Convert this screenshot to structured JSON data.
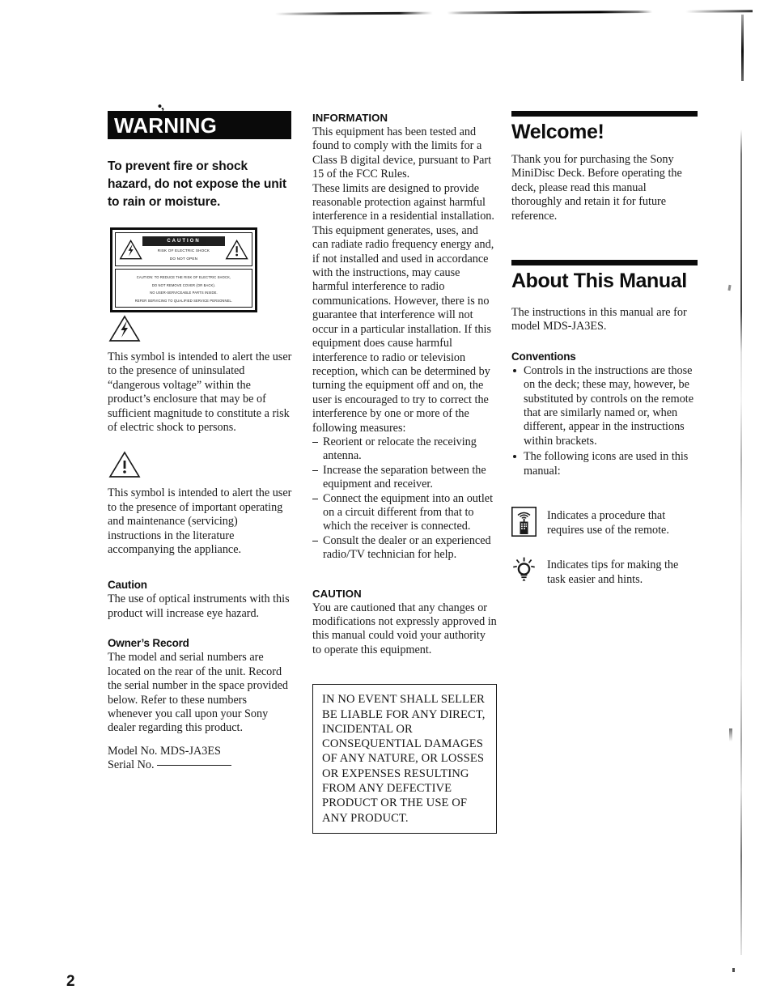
{
  "page": {
    "number": "2",
    "document_type": "owner-manual-page",
    "model": "MDS-JA3ES"
  },
  "artifacts": {
    "smudge_mark": "•,"
  },
  "left_column": {
    "warning_banner": "WARNING",
    "warning_lead": "To prevent fire or shock hazard, do not expose the unit to rain or moisture.",
    "caution_plate": {
      "caution_bar": "CAUTION",
      "line1": "RISK OF ELECTRIC SHOCK",
      "line2": "DO NOT OPEN",
      "bottom_line1": "CAUTION: TO REDUCE THE RISK OF ELECTRIC SHOCK,",
      "bottom_line2": "DO NOT REMOVE COVER (OR BACK).",
      "bottom_line3": "NO USER-SERVICEABLE PARTS INSIDE.",
      "bottom_line4": "REFER SERVICING TO QUALIFIED SERVICE PERSONNEL.",
      "left_symbol": "lightning-bolt-triangle-icon",
      "right_symbol": "exclamation-triangle-icon"
    },
    "lightning_symbol_text": "This symbol is intended to alert the user to the presence of uninsulated “dangerous voltage” within the product’s enclosure that may be of sufficient magnitude to constitute a risk of electric shock to persons.",
    "exclamation_symbol_text": "This symbol is intended to alert the user to the presence of important operating and maintenance (servicing) instructions in the literature accompanying the appliance.",
    "caution_heading": "Caution",
    "caution_text": "The use of optical instruments with this product will increase eye hazard.",
    "owners_record_heading": "Owner’s Record",
    "owners_record_text": "The model and serial numbers are located on the rear of the unit. Record the serial number in the space provided below. Refer to these numbers whenever you call upon your Sony dealer regarding this product.",
    "model_no_label": "Model No. MDS-JA3ES",
    "serial_no_label": "Serial No."
  },
  "middle_column": {
    "information_heading": "INFORMATION",
    "information_p1": "This equipment has been tested and found to comply with the limits for a Class B digital device, pursuant to Part 15 of the FCC Rules.",
    "information_p2": "These limits are designed to provide reasonable protection against harmful interference in a residential installation. This equipment generates, uses, and can radiate radio frequency energy and, if not installed and used in accordance with the instructions, may cause harmful interference to radio communications. However, there is no guarantee that interference will not occur in a particular installation. If this equipment does cause harmful interference to radio or television reception, which can be determined by turning the equipment off and on, the user is encouraged to try to correct the interference by one or more of the following measures:",
    "measures": [
      "Reorient or relocate the receiving antenna.",
      "Increase the separation between the equipment and receiver.",
      "Connect the equipment into an outlet on a circuit different from that to which the receiver is connected.",
      "Consult the dealer or an experienced radio/TV technician for help."
    ],
    "caution_heading": "CAUTION",
    "caution_text": "You are cautioned that any changes or modifications not expressly approved in this manual could void your authority to operate this equipment.",
    "liability_notice": "IN NO EVENT SHALL SELLER BE LIABLE FOR ANY DIRECT, INCIDENTAL OR CONSEQUENTIAL DAMAGES OF ANY NATURE, OR LOSSES OR EXPENSES RESULTING FROM ANY DEFECTIVE PRODUCT OR THE USE OF ANY PRODUCT."
  },
  "right_column": {
    "welcome_heading": "Welcome!",
    "welcome_text": "Thank you for purchasing the Sony MiniDisc Deck.  Before operating the deck, please read this manual thoroughly and retain it for future reference.",
    "about_heading": "About This Manual",
    "about_text": "The instructions in this manual are for model MDS-JA3ES.",
    "conventions_heading": "Conventions",
    "conventions_bullets": [
      "Controls in the instructions are those on the deck; these may, however, be substituted by controls on the remote that are similarly named or, when different, appear in the instructions within brackets.",
      "The following icons are used in this manual:"
    ],
    "icon_legend": [
      {
        "icon": "remote-control-icon",
        "text": "Indicates a procedure that requires use of the remote."
      },
      {
        "icon": "light-bulb-tip-icon",
        "text": "Indicates tips for making the task easier and hints."
      }
    ]
  }
}
